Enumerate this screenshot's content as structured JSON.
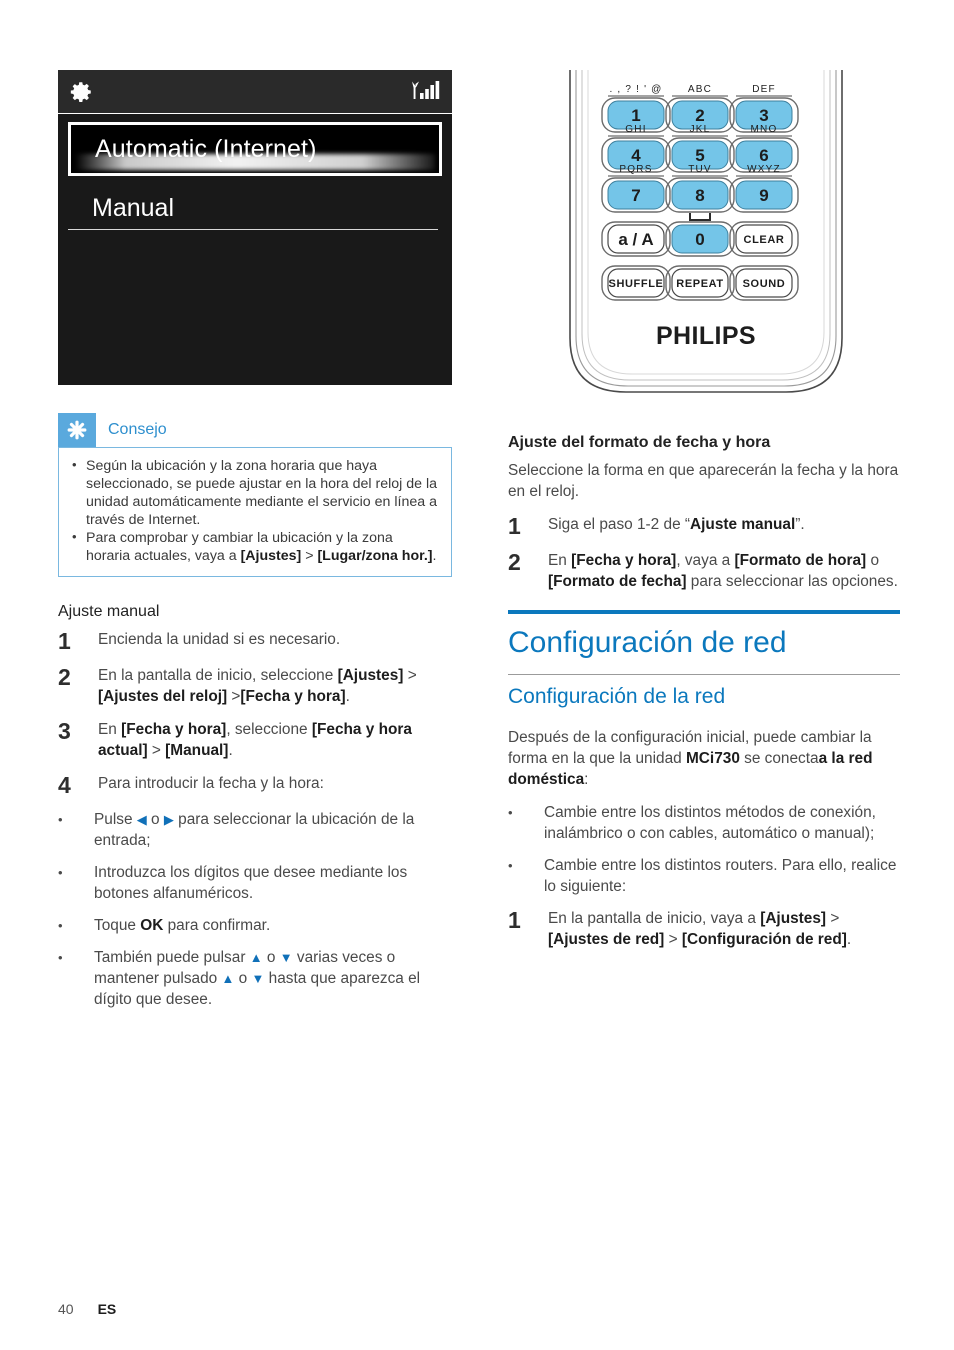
{
  "page": {
    "number": "40",
    "language_code": "ES"
  },
  "lcd": {
    "gear_icon": "gear-icon",
    "signal_icon": "wifi-signal-icon",
    "selected_item": "Automatic (Internet)",
    "items": [
      "Manual"
    ]
  },
  "tip": {
    "icon": "asterisk-tip-icon",
    "title": "Consejo",
    "accent_color": "#5aa9dd",
    "title_color": "#2e8fce",
    "bullets": [
      {
        "parts": [
          {
            "t": "Según la ubicación y la zona horaria que haya seleccionado, se puede ajustar en la hora del reloj de la unidad automáticamente mediante el servicio en línea a través de Internet.",
            "b": false
          }
        ]
      },
      {
        "parts": [
          {
            "t": "Para comprobar y cambiar la ubicación y la zona horaria actuales, vaya a ",
            "b": false
          },
          {
            "t": "[Ajustes]",
            "b": true
          },
          {
            "t": " > ",
            "b": false
          },
          {
            "t": "[Lugar/zona hor.]",
            "b": true
          },
          {
            "t": ".",
            "b": false
          }
        ]
      }
    ]
  },
  "manual_setting": {
    "heading": "Ajuste manual",
    "steps": [
      {
        "num": "1",
        "parts": [
          {
            "t": "Encienda la unidad si es necesario.",
            "b": false
          }
        ]
      },
      {
        "num": "2",
        "parts": [
          {
            "t": "En la pantalla de inicio, seleccione ",
            "b": false
          },
          {
            "t": "[Ajustes]",
            "b": true
          },
          {
            "t": " > ",
            "b": false
          },
          {
            "t": "[Ajustes del reloj]",
            "b": true
          },
          {
            "t": " >",
            "b": false
          },
          {
            "t": "[Fecha y hora]",
            "b": true
          },
          {
            "t": ".",
            "b": false
          }
        ]
      },
      {
        "num": "3",
        "parts": [
          {
            "t": "En ",
            "b": false
          },
          {
            "t": "[Fecha y hora]",
            "b": true
          },
          {
            "t": ", seleccione ",
            "b": false
          },
          {
            "t": "[Fecha y hora actual]",
            "b": true
          },
          {
            "t": " > ",
            "b": false
          },
          {
            "t": "[Manual]",
            "b": true
          },
          {
            "t": ".",
            "b": false
          }
        ]
      },
      {
        "num": "4",
        "parts": [
          {
            "t": "Para introducir la fecha y la hora:",
            "b": false
          }
        ]
      }
    ],
    "sub_bullets": [
      {
        "parts": [
          {
            "t": "Pulse ",
            "b": false
          },
          {
            "t": "◀",
            "arrow": true
          },
          {
            "t": " o ",
            "b": false
          },
          {
            "t": "▶",
            "arrow": true
          },
          {
            "t": " para seleccionar la ubicación de la entrada;",
            "b": false
          }
        ]
      },
      {
        "parts": [
          {
            "t": "Introduzca los dígitos que desee mediante los botones alfanuméricos.",
            "b": false
          }
        ]
      },
      {
        "parts": [
          {
            "t": "Toque ",
            "b": false
          },
          {
            "t": "OK",
            "b": true
          },
          {
            "t": " para confirmar.",
            "b": false
          }
        ]
      },
      {
        "parts": [
          {
            "t": "También puede pulsar ",
            "b": false
          },
          {
            "t": "▲",
            "arrow": true
          },
          {
            "t": " o ",
            "b": false
          },
          {
            "t": "▼",
            "arrow": true
          },
          {
            "t": " varias veces o mantener pulsado ",
            "b": false
          },
          {
            "t": "▲",
            "arrow": true
          },
          {
            "t": " o ",
            "b": false
          },
          {
            "t": "▼",
            "arrow": true
          },
          {
            "t": " hasta que aparezca el dígito que desee.",
            "b": false
          }
        ]
      }
    ]
  },
  "remote": {
    "brand": "PHILIPS",
    "key_color": "#74c5e8",
    "keys": [
      {
        "label": "1",
        "top": ". , ? ! ' @",
        "highlighted": true
      },
      {
        "label": "2",
        "top": "ABC",
        "highlighted": true
      },
      {
        "label": "3",
        "top": "DEF",
        "highlighted": true
      },
      {
        "label": "4",
        "top": "GHI",
        "highlighted": true
      },
      {
        "label": "5",
        "top": "JKL",
        "highlighted": true
      },
      {
        "label": "6",
        "top": "MNO",
        "highlighted": true
      },
      {
        "label": "7",
        "top": "PQRS",
        "highlighted": true
      },
      {
        "label": "8",
        "top": "TUV",
        "highlighted": true
      },
      {
        "label": "9",
        "top": "WXYZ",
        "highlighted": true
      },
      {
        "label": "a / A",
        "top": "",
        "highlighted": false
      },
      {
        "label": "0",
        "top": "⎵",
        "highlighted": true
      },
      {
        "label": "CLEAR",
        "top": "",
        "highlighted": false
      },
      {
        "label": "SHUFFLE",
        "top": "",
        "highlighted": false
      },
      {
        "label": "REPEAT",
        "top": "",
        "highlighted": false
      },
      {
        "label": "SOUND",
        "top": "",
        "highlighted": false
      }
    ]
  },
  "datetime_format": {
    "heading": "Ajuste del formato de fecha y hora",
    "intro": "Seleccione la forma en que aparecerán la fecha y la hora en el reloj.",
    "steps": [
      {
        "num": "1",
        "parts": [
          {
            "t": "Siga el paso 1-2 de “",
            "b": false
          },
          {
            "t": "Ajuste manual",
            "b": true
          },
          {
            "t": "”.",
            "b": false
          }
        ]
      },
      {
        "num": "2",
        "parts": [
          {
            "t": "En ",
            "b": false
          },
          {
            "t": "[Fecha y hora]",
            "b": true
          },
          {
            "t": ", vaya a ",
            "b": false
          },
          {
            "t": "[Formato de hora]",
            "b": true
          },
          {
            "t": " o ",
            "b": false
          },
          {
            "t": "[Formato de fecha]",
            "b": true
          },
          {
            "t": " para seleccionar las opciones.",
            "b": false
          }
        ]
      }
    ]
  },
  "network": {
    "title": "Configuración de red",
    "title_color": "#0b78bd",
    "subtitle": "Configuración de la red",
    "intro_parts": [
      {
        "t": "Después de la configuración inicial, puede cambiar la forma en la que la unidad ",
        "b": false
      },
      {
        "t": "MCi730",
        "b": true
      },
      {
        "t": " se conecta",
        "b": false
      },
      {
        "t": "a la red doméstica",
        "b": true
      },
      {
        "t": ":",
        "b": false
      }
    ],
    "bullets": [
      {
        "parts": [
          {
            "t": "Cambie entre los distintos métodos de conexión, inalámbrico o con cables, automático o manual);",
            "b": false
          }
        ]
      },
      {
        "parts": [
          {
            "t": "Cambie entre los distintos routers. Para ello, realice lo siguiente:",
            "b": false
          }
        ]
      }
    ],
    "steps": [
      {
        "num": "1",
        "parts": [
          {
            "t": "En la pantalla de inicio, vaya a ",
            "b": false
          },
          {
            "t": "[Ajustes]",
            "b": true
          },
          {
            "t": " > ",
            "b": false
          },
          {
            "t": "[Ajustes de red]",
            "b": true
          },
          {
            "t": " > ",
            "b": false
          },
          {
            "t": "[Configuración de red]",
            "b": true
          },
          {
            "t": ".",
            "b": false
          }
        ]
      }
    ]
  }
}
